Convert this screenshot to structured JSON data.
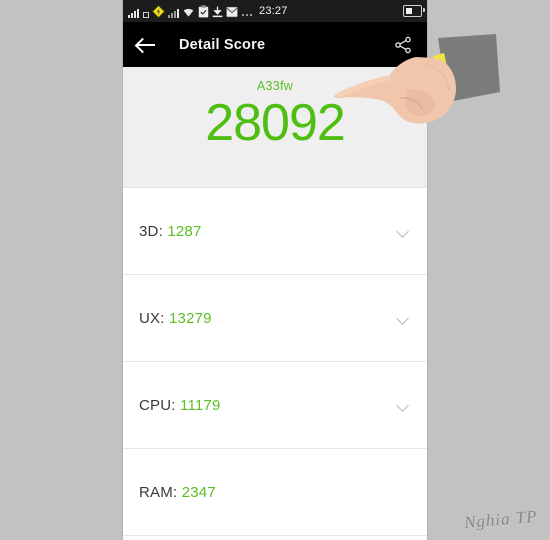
{
  "statusbar": {
    "time": "23:27",
    "icons": [
      "signal-bars-icon",
      "yellow-diamond-icon",
      "signal-bars-icon",
      "wifi-icon",
      "clipboard-icon",
      "download-icon",
      "mail-icon",
      "more-dots-icon"
    ],
    "battery": "battery-half-icon"
  },
  "appbar": {
    "back_label": "back-arrow",
    "title": "Detail Score",
    "share_label": "share"
  },
  "score": {
    "device_name": "A33fw",
    "total": "28092",
    "accent_color": "#4fbe12",
    "panel_bg": "#efefef"
  },
  "rows": [
    {
      "label": "3D:",
      "value": "1287",
      "chevron": true
    },
    {
      "label": "UX:",
      "value": "13279",
      "chevron": true
    },
    {
      "label": "CPU:",
      "value": "11179",
      "chevron": true
    },
    {
      "label": "RAM:",
      "value": "2347",
      "chevron": false
    }
  ],
  "watermark": {
    "text": "Nghia TP"
  },
  "canvas": {
    "background": "#c2c2c3"
  }
}
